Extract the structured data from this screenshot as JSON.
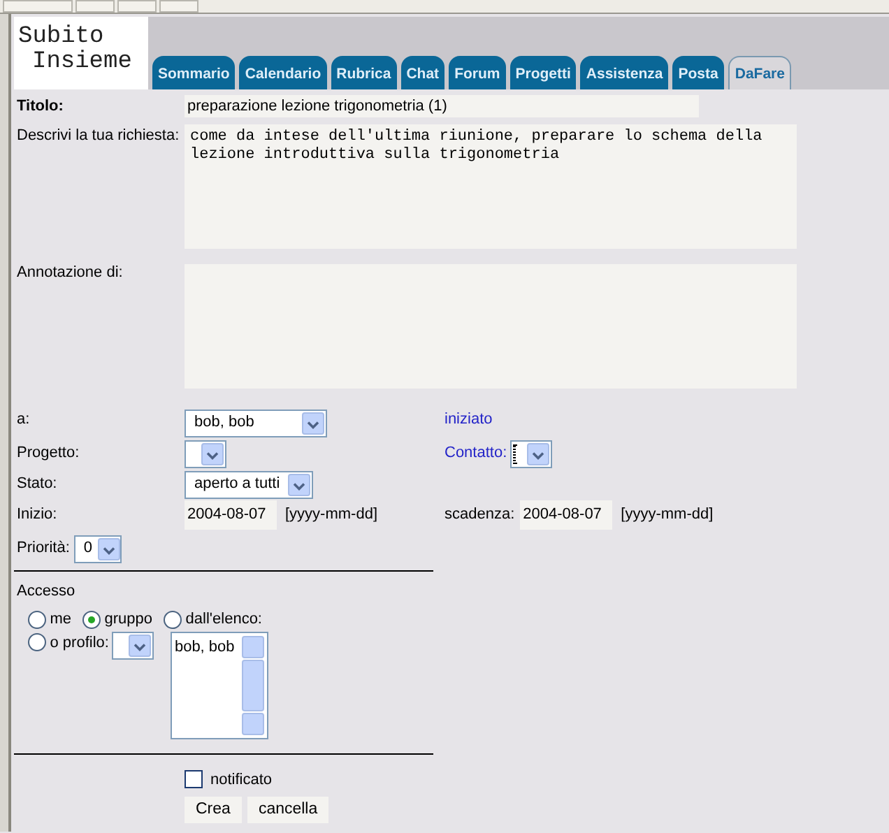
{
  "logo": {
    "lines": [
      "Subito",
      "Insieme"
    ]
  },
  "tabs": [
    {
      "label": "Sommario",
      "selected": false
    },
    {
      "label": "Calendario",
      "selected": false
    },
    {
      "label": "Rubrica",
      "selected": false
    },
    {
      "label": "Chat",
      "selected": false
    },
    {
      "label": "Forum",
      "selected": false
    },
    {
      "label": "Progetti",
      "selected": false
    },
    {
      "label": "Assistenza",
      "selected": false
    },
    {
      "label": "Posta",
      "selected": false
    },
    {
      "label": "DaFare",
      "selected": true
    }
  ],
  "title": {
    "label": "Titolo:",
    "value": "preparazione lezione trigonometria (1)"
  },
  "description": {
    "label": "Descrivi la tua richiesta:",
    "value": "come da intese dell'ultima riunione, preparare lo schema della lezione introduttiva sulla trigonometria"
  },
  "annotation": {
    "label": "Annotazione di:"
  },
  "assignee": {
    "label": "a:",
    "value": "bob, bob"
  },
  "status_text": "iniziato",
  "project": {
    "label": "Progetto:"
  },
  "contact": {
    "label": "Contatto:"
  },
  "state": {
    "label": "Stato:",
    "value": "aperto a tutti"
  },
  "start": {
    "label": "Inizio:",
    "value": "2004-08-07",
    "hint": "[yyyy-mm-dd]"
  },
  "due": {
    "label": "scadenza:",
    "value": "2004-08-07",
    "hint": "[yyyy-mm-dd]"
  },
  "priority": {
    "label": "Priorità:",
    "value": "0"
  },
  "access": {
    "title": "Accesso",
    "options": [
      {
        "label": "me",
        "selected": false
      },
      {
        "label": "gruppo",
        "selected": true
      },
      {
        "label": "dall'elenco:",
        "selected": false
      },
      {
        "label": "o profilo:",
        "selected": false
      }
    ],
    "list_items": [
      "bob, bob"
    ]
  },
  "notify": {
    "label": "notificato",
    "checked": false
  },
  "buttons": [
    "Crea",
    "cancella"
  ]
}
